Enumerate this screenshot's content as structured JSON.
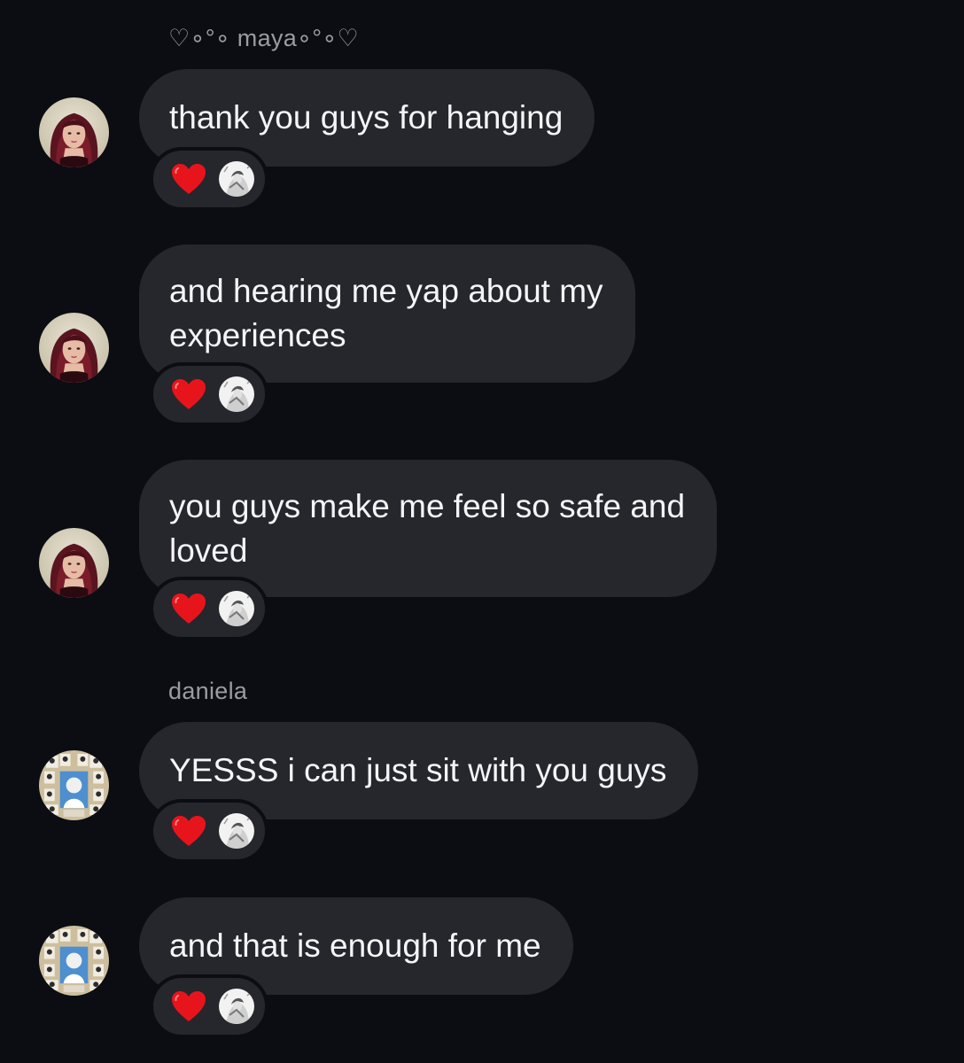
{
  "senders": {
    "maya": "♡∘°∘ maya∘°∘♡",
    "daniela": "daniela"
  },
  "messages": [
    {
      "sender": "maya",
      "text": "thank you guys for hanging",
      "reaction": "heart-emoji"
    },
    {
      "sender": "maya",
      "text": "and hearing me yap about my\nexperiences",
      "reaction": "heart-emoji"
    },
    {
      "sender": "maya",
      "text": "you guys make me feel so safe and\nloved",
      "reaction": "heart-emoji"
    },
    {
      "sender": "daniela",
      "text": "YESSS i can just sit with you guys",
      "reaction": "heart-emoji"
    },
    {
      "sender": "daniela",
      "text": "and that is enough for me",
      "reaction": "heart-emoji"
    }
  ],
  "colors": {
    "background": "#0b0d12",
    "bubble": "#25272c",
    "text": "#f5f5f7",
    "sender_name": "#9a9ca3",
    "heart": "#e8141c"
  }
}
